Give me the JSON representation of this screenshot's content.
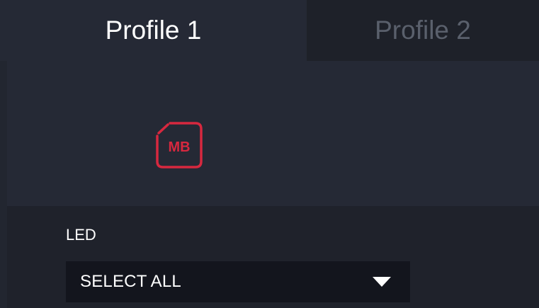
{
  "tabs": [
    {
      "label": "Profile 1",
      "active": true
    },
    {
      "label": "Profile 2",
      "active": false
    }
  ],
  "device": {
    "icon": "mb-device-icon",
    "badge_text": "MB",
    "accent_color": "#d7283f"
  },
  "led": {
    "label": "LED",
    "select_value": "SELECT ALL"
  },
  "colors": {
    "background": "#252935",
    "panel": "#1f222b",
    "select_bg": "#13151d",
    "inactive_tab": "#1e2129",
    "inactive_text": "#5a606c"
  }
}
